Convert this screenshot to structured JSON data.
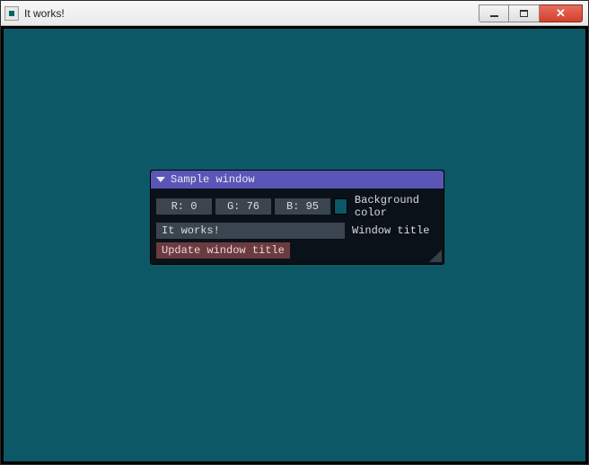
{
  "window": {
    "title": "It works!"
  },
  "panel": {
    "title": "Sample window",
    "bg_label": "Background color",
    "r_label": "R:",
    "r_value": "0",
    "g_label": "G:",
    "g_value": "76",
    "b_label": "B:",
    "b_value": "95",
    "swatch_hex": "#0c5866",
    "title_input_value": "It works!",
    "title_input_label": "Window title",
    "update_button": "Update window title"
  }
}
